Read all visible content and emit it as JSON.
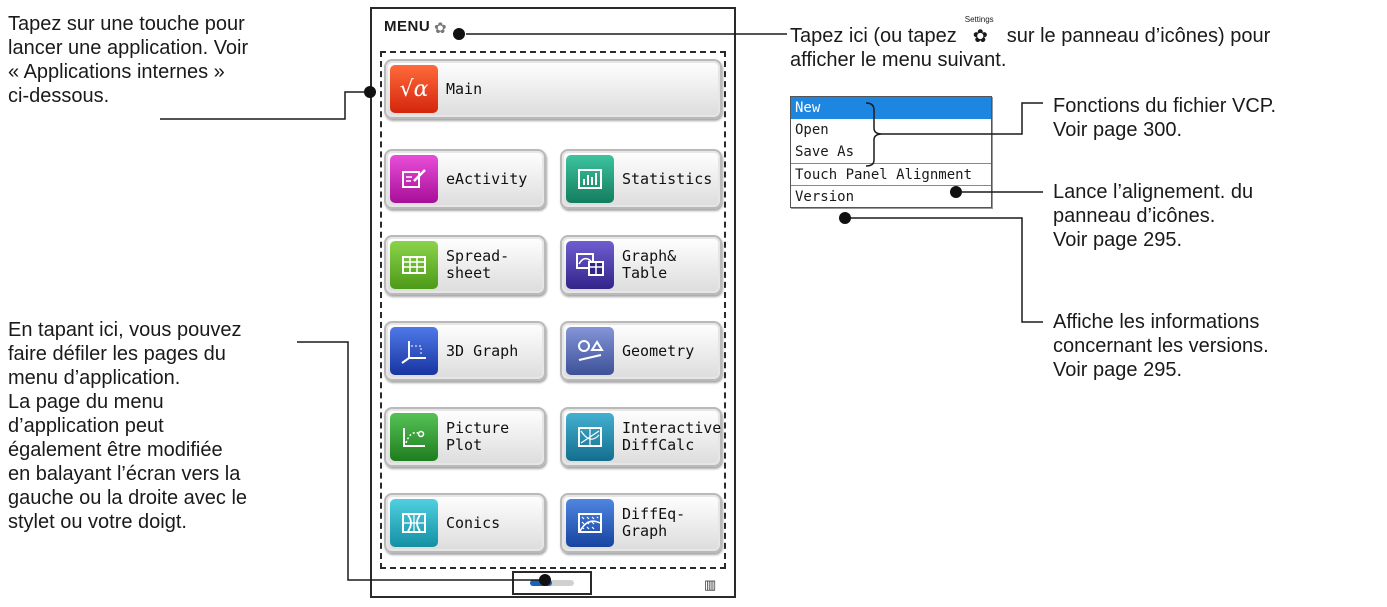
{
  "annotations": {
    "apps_tap": [
      "Tapez sur une touche pour",
      "lancer une application. Voir",
      "« Applications internes »",
      "ci-dessous."
    ],
    "pager_tap": [
      "En tapant ici, vous pouvez",
      "faire défiler les pages du",
      "menu d’application.",
      "La page du menu",
      "d’application peut",
      "également être modifiée",
      "en balayant l’écran vers la",
      "gauche ou la droite avec le",
      "stylet ou votre doigt."
    ],
    "menu_tap_line1_a": "Tapez ici (ou tapez",
    "menu_tap_line1_b": "sur le panneau d’icônes) pour",
    "menu_tap_line2": "afficher le menu suivant.",
    "settings_key_label": "Settings",
    "vcp": [
      "Fonctions du fichier VCP.",
      "Voir page 300."
    ],
    "alignment": [
      "Lance l’alignement. du",
      "panneau d’icônes.",
      "Voir page 295."
    ],
    "version": [
      "Affiche les informations",
      "concernant les versions.",
      "Voir page 295."
    ]
  },
  "device": {
    "menu_label": "MENU",
    "battery": "battery-icon",
    "page_indicator": {
      "current": 1,
      "total": 2
    }
  },
  "apps": [
    {
      "label": "Main",
      "icon": "sqrt-alpha-icon",
      "color": "#e8381e",
      "glyph": "√α"
    },
    {
      "label": "eActivity",
      "icon": "eactivity-icon",
      "color": "#c41fb4",
      "glyph": ""
    },
    {
      "label": "Statistics",
      "icon": "statistics-icon",
      "color": "#1e9c7a",
      "glyph": ""
    },
    {
      "label": "Spread-\nsheet",
      "icon": "spreadsheet-icon",
      "color": "#66b52a",
      "glyph": ""
    },
    {
      "label": "Graph&\nTable",
      "icon": "graph-table-icon",
      "color": "#4b3ca8",
      "glyph": ""
    },
    {
      "label": "3D Graph",
      "icon": "3d-graph-icon",
      "color": "#2b52c6",
      "glyph": ""
    },
    {
      "label": "Geometry",
      "icon": "geometry-icon",
      "color": "#5a6fb4",
      "glyph": ""
    },
    {
      "label": "Picture\nPlot",
      "icon": "picture-plot-icon",
      "color": "#2e9a2e",
      "glyph": ""
    },
    {
      "label": "Interactive\nDiffCalc",
      "icon": "diffcalc-icon",
      "color": "#1f8cae",
      "glyph": ""
    },
    {
      "label": "Conics",
      "icon": "conics-icon",
      "color": "#27b2c4",
      "glyph": ""
    },
    {
      "label": "DiffEq-\nGraph",
      "icon": "diffeq-graph-icon",
      "color": "#2c62c0",
      "glyph": ""
    }
  ],
  "file_menu": [
    {
      "label": "New",
      "selected": true
    },
    {
      "label": "Open",
      "selected": false
    },
    {
      "label": "Save As",
      "selected": false
    },
    {
      "label": "Touch Panel Alignment",
      "selected": false
    },
    {
      "label": "Version",
      "selected": false
    }
  ]
}
